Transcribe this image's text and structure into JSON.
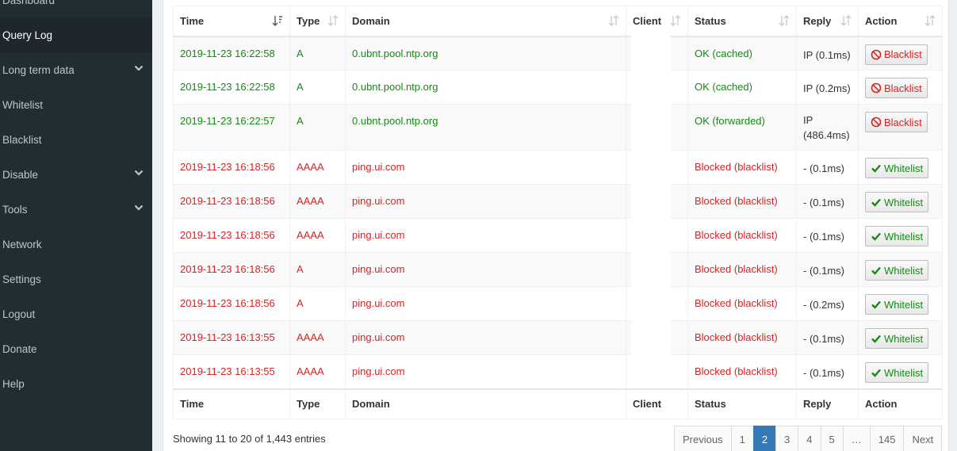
{
  "sidebar": {
    "items": [
      {
        "label": "Dashboard",
        "active": false,
        "expandable": false
      },
      {
        "label": "Query Log",
        "active": true,
        "expandable": false
      },
      {
        "label": "Long term data",
        "active": false,
        "expandable": true
      },
      {
        "label": "Whitelist",
        "active": false,
        "expandable": false
      },
      {
        "label": "Blacklist",
        "active": false,
        "expandable": false
      },
      {
        "label": "Disable",
        "active": false,
        "expandable": true
      },
      {
        "label": "Tools",
        "active": false,
        "expandable": true
      },
      {
        "label": "Network",
        "active": false,
        "expandable": false
      },
      {
        "label": "Settings",
        "active": false,
        "expandable": false
      },
      {
        "label": "Logout",
        "active": false,
        "expandable": false
      },
      {
        "label": "Donate",
        "active": false,
        "expandable": false
      },
      {
        "label": "Help",
        "active": false,
        "expandable": false
      }
    ]
  },
  "table": {
    "columns": [
      "Time",
      "Type",
      "Domain",
      "Client",
      "Status",
      "Reply",
      "Action"
    ],
    "sorted_column": "Time",
    "sort_direction": "desc",
    "rows": [
      {
        "time": "2019-11-23 16:22:58",
        "type": "A",
        "domain": "0.ubnt.pool.ntp.org",
        "client": "",
        "status": "OK (cached)",
        "reply": "IP (0.1ms)",
        "action": "Blacklist",
        "kind": "ok"
      },
      {
        "time": "2019-11-23 16:22:58",
        "type": "A",
        "domain": "0.ubnt.pool.ntp.org",
        "client": "",
        "status": "OK (cached)",
        "reply": "IP (0.2ms)",
        "action": "Blacklist",
        "kind": "ok"
      },
      {
        "time": "2019-11-23 16:22:57",
        "type": "A",
        "domain": "0.ubnt.pool.ntp.org",
        "client": "",
        "status": "OK (forwarded)",
        "reply": "IP (486.4ms)",
        "action": "Blacklist",
        "kind": "ok"
      },
      {
        "time": "2019-11-23 16:18:56",
        "type": "AAAA",
        "domain": "ping.ui.com",
        "client": "",
        "status": "Blocked (blacklist)",
        "reply": "- (0.1ms)",
        "action": "Whitelist",
        "kind": "blocked"
      },
      {
        "time": "2019-11-23 16:18:56",
        "type": "AAAA",
        "domain": "ping.ui.com",
        "client": "",
        "status": "Blocked (blacklist)",
        "reply": "- (0.1ms)",
        "action": "Whitelist",
        "kind": "blocked"
      },
      {
        "time": "2019-11-23 16:18:56",
        "type": "AAAA",
        "domain": "ping.ui.com",
        "client": "",
        "status": "Blocked (blacklist)",
        "reply": "- (0.1ms)",
        "action": "Whitelist",
        "kind": "blocked"
      },
      {
        "time": "2019-11-23 16:18:56",
        "type": "A",
        "domain": "ping.ui.com",
        "client": "",
        "status": "Blocked (blacklist)",
        "reply": "- (0.1ms)",
        "action": "Whitelist",
        "kind": "blocked"
      },
      {
        "time": "2019-11-23 16:18:56",
        "type": "A",
        "domain": "ping.ui.com",
        "client": "",
        "status": "Blocked (blacklist)",
        "reply": "- (0.2ms)",
        "action": "Whitelist",
        "kind": "blocked"
      },
      {
        "time": "2019-11-23 16:13:55",
        "type": "AAAA",
        "domain": "ping.ui.com",
        "client": "",
        "status": "Blocked (blacklist)",
        "reply": "- (0.1ms)",
        "action": "Whitelist",
        "kind": "blocked"
      },
      {
        "time": "2019-11-23 16:13:55",
        "type": "AAAA",
        "domain": "ping.ui.com",
        "client": "",
        "status": "Blocked (blacklist)",
        "reply": "- (0.1ms)",
        "action": "Whitelist",
        "kind": "blocked"
      }
    ]
  },
  "footer": {
    "info": "Showing 11 to 20 of 1,443 entries",
    "pagination": [
      "Previous",
      "1",
      "2",
      "3",
      "4",
      "5",
      "…",
      "145",
      "Next"
    ],
    "active_page": "2"
  },
  "colors": {
    "ok": "#158915",
    "blocked": "#d62323",
    "sidebar_bg": "#222d32",
    "active_page": "#337ab7"
  },
  "icons": {
    "sort_desc": "sort-desc-icon",
    "sort_both": "sort-both-icon",
    "blacklist": "ban-icon",
    "whitelist": "check-icon",
    "expand": "chevron-down-icon"
  }
}
